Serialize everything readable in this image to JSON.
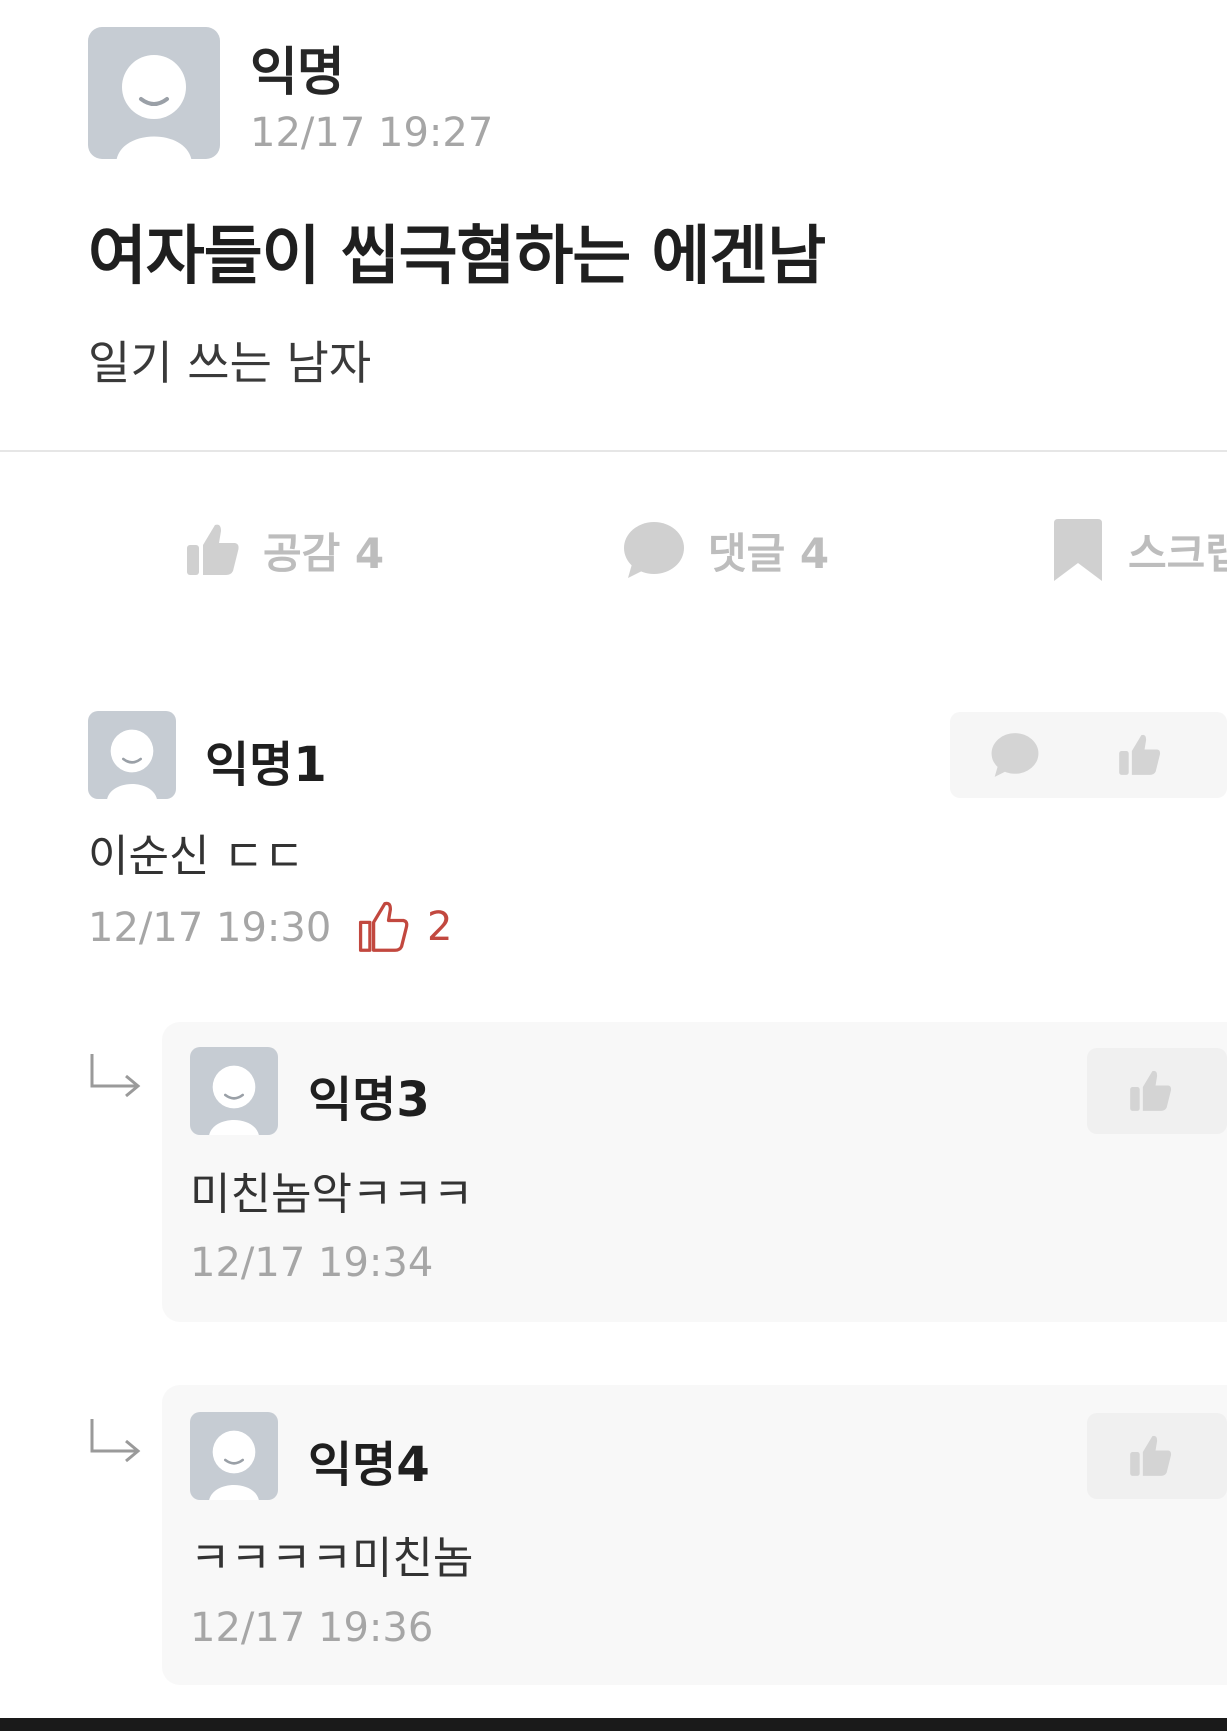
{
  "post": {
    "author": "익명",
    "time": "12/17 19:27",
    "title": "여자들이 씹극혐하는 에겐남",
    "body": "일기 쓰는 남자"
  },
  "actions": {
    "like_label": "공감 4",
    "comment_label": "댓글 4",
    "scrap_label": "스크랩"
  },
  "comments": [
    {
      "author": "익명1",
      "text": "이순신 ㄷㄷ",
      "time": "12/17 19:30",
      "likes": "2"
    }
  ],
  "replies": [
    {
      "author": "익명3",
      "text": "미친놈악ㅋㅋㅋ",
      "time": "12/17 19:34"
    },
    {
      "author": "익명4",
      "text": "ㅋㅋㅋㅋ미친놈",
      "time": "12/17 19:36"
    }
  ],
  "icons": [
    "thumbs-up-icon",
    "speech-bubble-icon",
    "bookmark-icon",
    "reply-arrow-icon",
    "avatar-icon"
  ],
  "colors": {
    "muted": "#bdbdbd",
    "like_accent": "#c2483f",
    "avatar_bg": "#c6ccd3"
  }
}
